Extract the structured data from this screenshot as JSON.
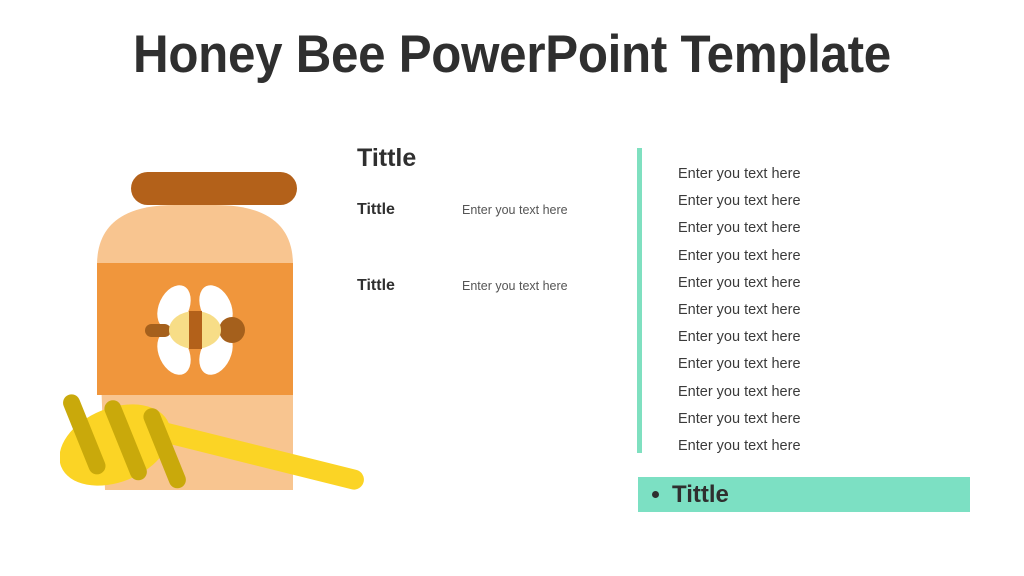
{
  "slide": {
    "title": "Honey Bee PowerPoint Template",
    "background_color": "#ffffff",
    "title_color": "#2f2f2f"
  },
  "illustration": {
    "name": "honey-jar-with-dipper",
    "colors": {
      "lid": "#b3611a",
      "jar_body": "#f8c590",
      "label_band": "#f0963c",
      "flower_petals": "#ffffff",
      "bee_body": "#f7dd87",
      "bee_stripe": "#b3611a",
      "bee_head": "#b3611a",
      "dipper_light": "#fbd425",
      "dipper_dark": "#c9a90b"
    }
  },
  "middle_column": {
    "heading": "Tittle",
    "rows": [
      {
        "label": "Tittle",
        "text": "Enter you text here"
      },
      {
        "label": "Tittle",
        "text": "Enter you text here"
      }
    ]
  },
  "right_column": {
    "accent_color": "#7fe0c0",
    "items": [
      "Enter you text here",
      "Enter you text here",
      "Enter you text here",
      "Enter you text here",
      "Enter you text here",
      "Enter you text here",
      "Enter you text here",
      "Enter you text here",
      "Enter you text here",
      "Enter you text here",
      "Enter you text here"
    ]
  },
  "banner": {
    "label": "Tittle",
    "background_color": "#7ce0c3",
    "bullet": "•"
  }
}
